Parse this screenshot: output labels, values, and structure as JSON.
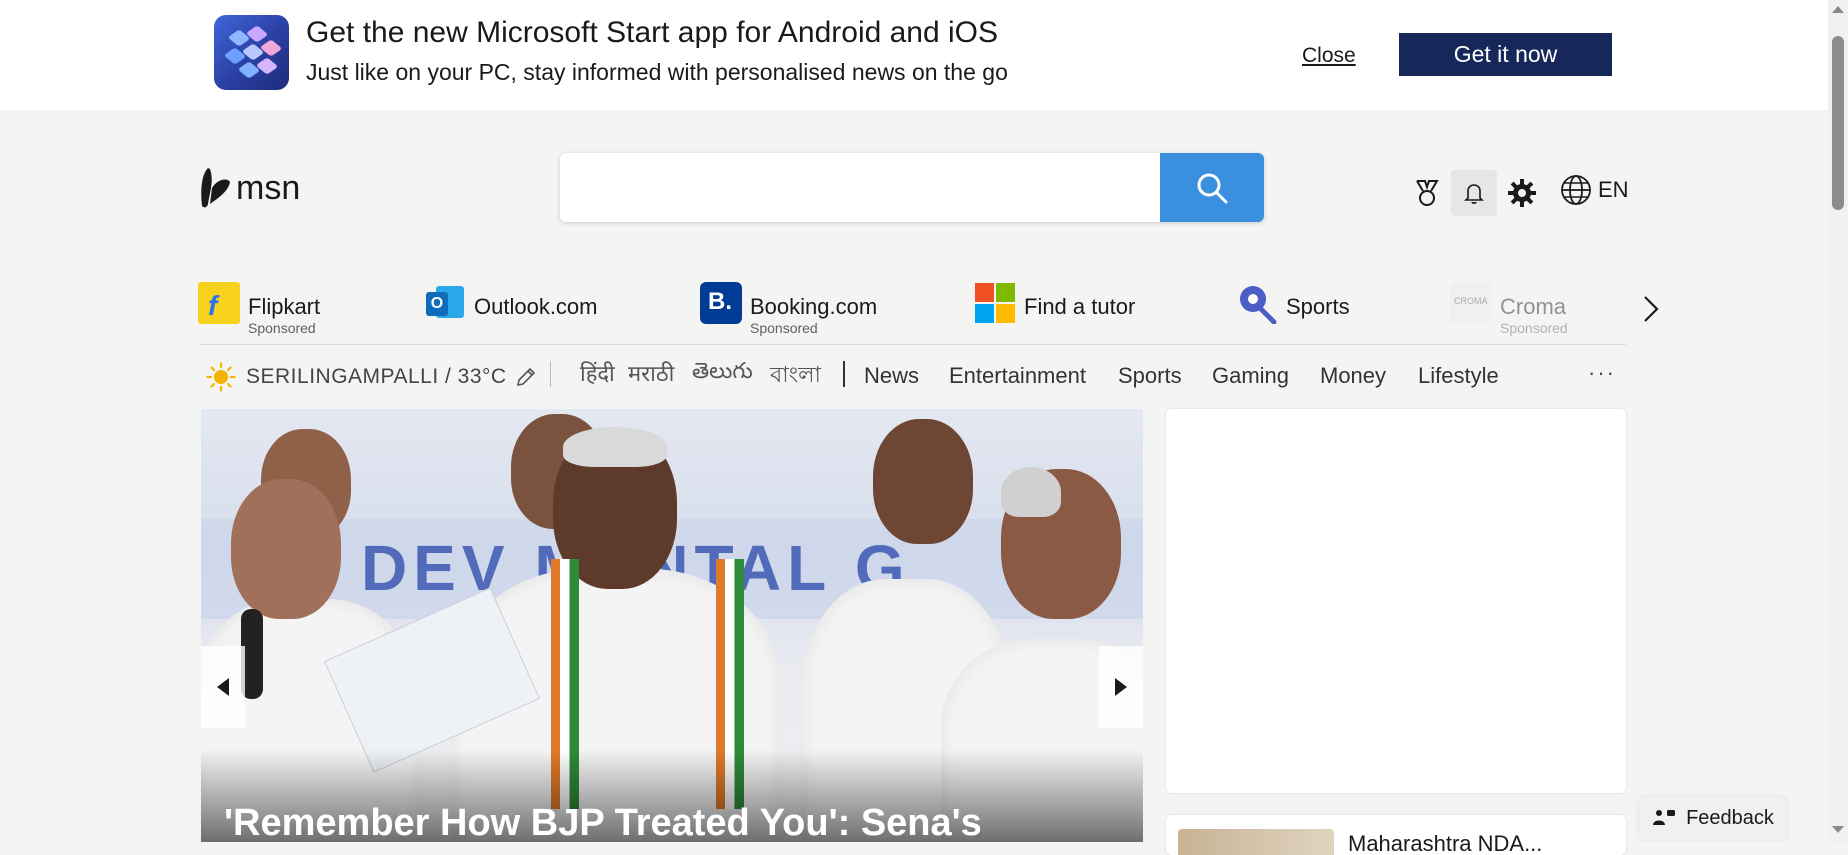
{
  "banner": {
    "title": "Get the new Microsoft Start app for Android and iOS",
    "subtitle": "Just like on your PC, stay informed with personalised news on the go",
    "close_label": "Close",
    "cta_label": "Get it now",
    "cta_color": "#16285a"
  },
  "header": {
    "logo_text": "msn",
    "search_placeholder": "",
    "search_button_color": "#3a8fde",
    "language": "EN",
    "icons": [
      "rewards-icon",
      "bell-icon",
      "gear-icon",
      "globe-icon"
    ]
  },
  "quick_links": [
    {
      "label": "Flipkart",
      "sponsored": "Sponsored",
      "icon": "flipkart-icon"
    },
    {
      "label": "Outlook.com",
      "sponsored": "",
      "icon": "outlook-icon"
    },
    {
      "label": "Booking.com",
      "sponsored": "Sponsored",
      "icon": "booking-icon"
    },
    {
      "label": "Find a tutor",
      "sponsored": "",
      "icon": "windows-tiles-icon"
    },
    {
      "label": "Sports",
      "sponsored": "",
      "icon": "sports-icon"
    },
    {
      "label": "Croma",
      "sponsored": "Sponsored",
      "icon": "croma-icon"
    }
  ],
  "weather": {
    "text": "SERILINGAMPALLI / 33°C"
  },
  "languages": [
    "हिंदी",
    "मराठी",
    "తెలుగు",
    "বাংলা"
  ],
  "nav": [
    "News",
    "Entertainment",
    "Sports",
    "Gaming",
    "Money",
    "Lifestyle"
  ],
  "more_label": "···",
  "hero": {
    "headline": "'Remember How BJP Treated You': Sena's",
    "wordmark": "AL DEV   MENTAL   G"
  },
  "side_card": {
    "text": "Maharashtra NDA..."
  },
  "feedback_label": "Feedback"
}
